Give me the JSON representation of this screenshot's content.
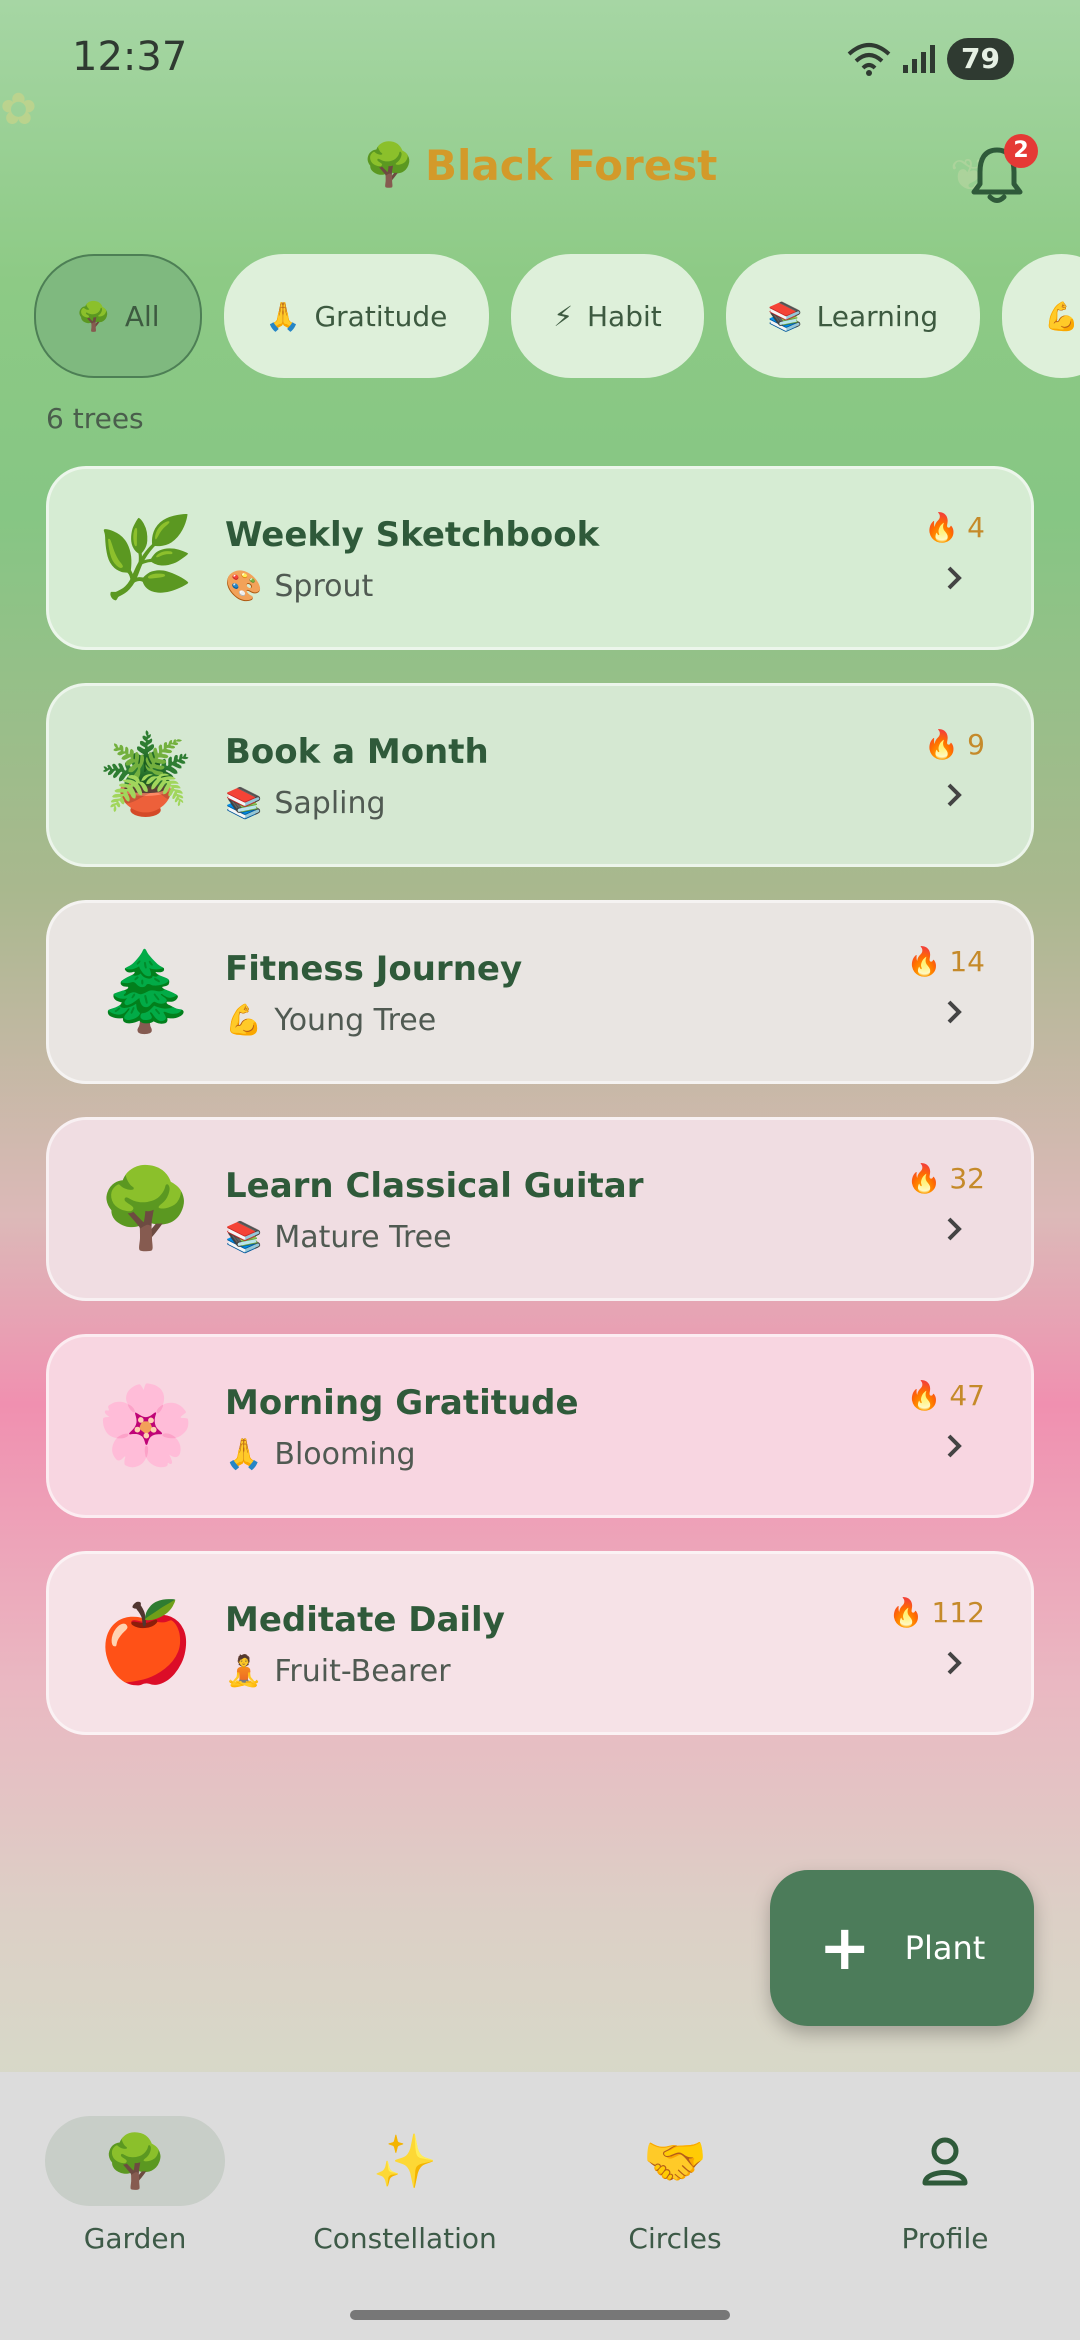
{
  "status_bar": {
    "time": "12:37",
    "battery": "79"
  },
  "header": {
    "title": "Black Forest",
    "title_emoji": "🌳",
    "notification_count": "2"
  },
  "filters": [
    {
      "emoji": "🌳",
      "label": "All",
      "active": true
    },
    {
      "emoji": "🙏",
      "label": "Gratitude",
      "active": false
    },
    {
      "emoji": "⚡",
      "label": "Habit",
      "active": false
    },
    {
      "emoji": "📚",
      "label": "Learning",
      "active": false
    },
    {
      "emoji": "💪",
      "label": "",
      "active": false
    }
  ],
  "tree_count": "6 trees",
  "trees": [
    {
      "emoji": "🌿",
      "title": "Weekly Sketchbook",
      "stage_emoji": "🎨",
      "stage": "Sprout",
      "streak": "4",
      "bg": "#d6ecd3"
    },
    {
      "emoji": "🪴",
      "title": "Book a Month",
      "stage_emoji": "📚",
      "stage": "Sapling",
      "streak": "9",
      "bg": "#d5e8d2"
    },
    {
      "emoji": "🌲",
      "title": "Fitness Journey",
      "stage_emoji": "💪",
      "stage": "Young Tree",
      "streak": "14",
      "bg": "#e9e5e2"
    },
    {
      "emoji": "🌳",
      "title": "Learn Classical Guitar",
      "stage_emoji": "📚",
      "stage": "Mature Tree",
      "streak": "32",
      "bg": "#f0dde2"
    },
    {
      "emoji": "🌸",
      "title": "Morning Gratitude",
      "stage_emoji": "🙏",
      "stage": "Blooming",
      "streak": "47",
      "bg": "#f8d6e1"
    },
    {
      "emoji": "🍎",
      "title": "Meditate Daily",
      "stage_emoji": "🧘",
      "stage": "Fruit-Bearer",
      "streak": "112",
      "bg": "#f6e2e7"
    }
  ],
  "fab": {
    "label": "Plant"
  },
  "nav": [
    {
      "emoji": "🌳",
      "label": "Garden",
      "active": true
    },
    {
      "emoji": "✨",
      "label": "Constellation",
      "active": false
    },
    {
      "emoji": "🤝",
      "label": "Circles",
      "active": false
    },
    {
      "emoji": "",
      "label": "Profile",
      "active": false
    }
  ],
  "colors": {
    "accent": "#4c7c5a",
    "title": "#d39a2a",
    "streak": "#c58a2a",
    "badge": "#e53935"
  }
}
